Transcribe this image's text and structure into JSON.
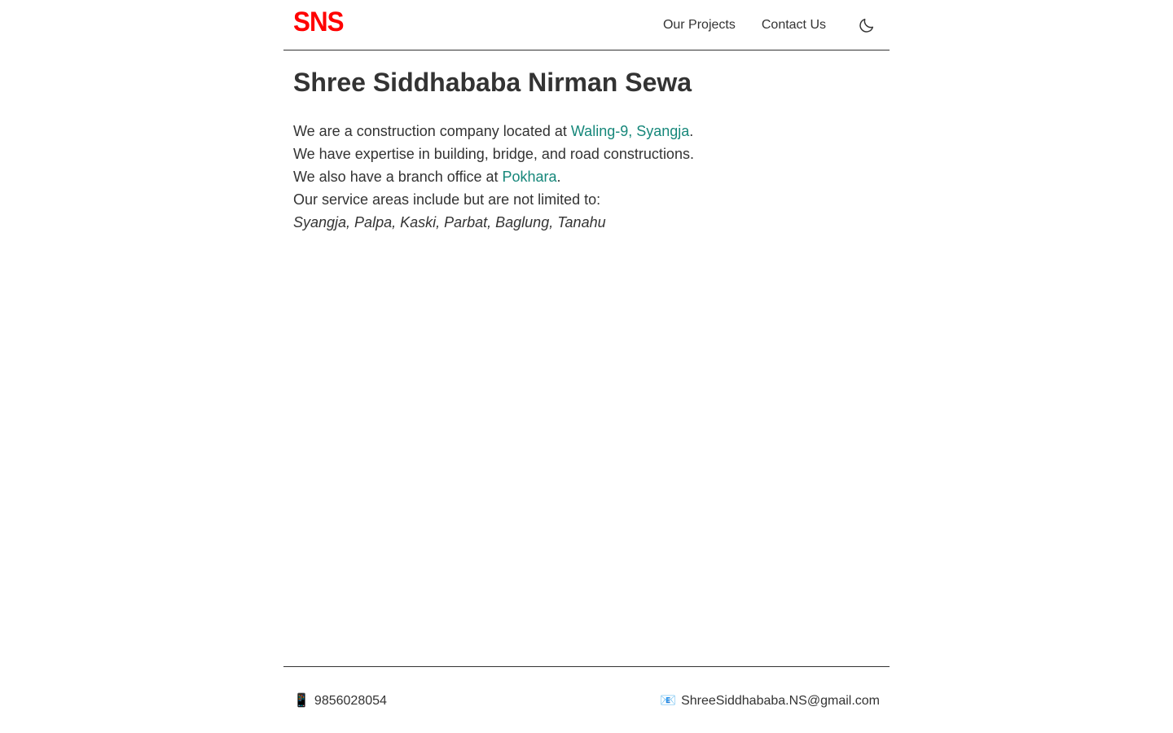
{
  "header": {
    "logo": "SNS",
    "nav": {
      "projects": "Our Projects",
      "contact": "Contact Us"
    },
    "theme_toggle_icon": "moon-icon"
  },
  "main": {
    "title": "Shree Siddhababa Nirman Sewa",
    "line1_prefix": "We are a construction company located at ",
    "line1_link": "Waling-9, Syangja",
    "line1_suffix": ".",
    "line2": "We have expertise in building, bridge, and road constructions.",
    "line3_prefix": "We also have a branch office at ",
    "line3_link": "Pokhara",
    "line3_suffix": ".",
    "line4": "Our service areas include but are not limited to:",
    "areas": "Syangja, Palpa, Kaski, Parbat, Baglung, Tanahu"
  },
  "footer": {
    "phone_icon": "📱",
    "phone": "9856028054",
    "email_icon": "📧",
    "email": "ShreeSiddhababa.NS@gmail.com"
  },
  "colors": {
    "logo": "#ff0000",
    "link": "#16877a",
    "text": "#333333"
  }
}
